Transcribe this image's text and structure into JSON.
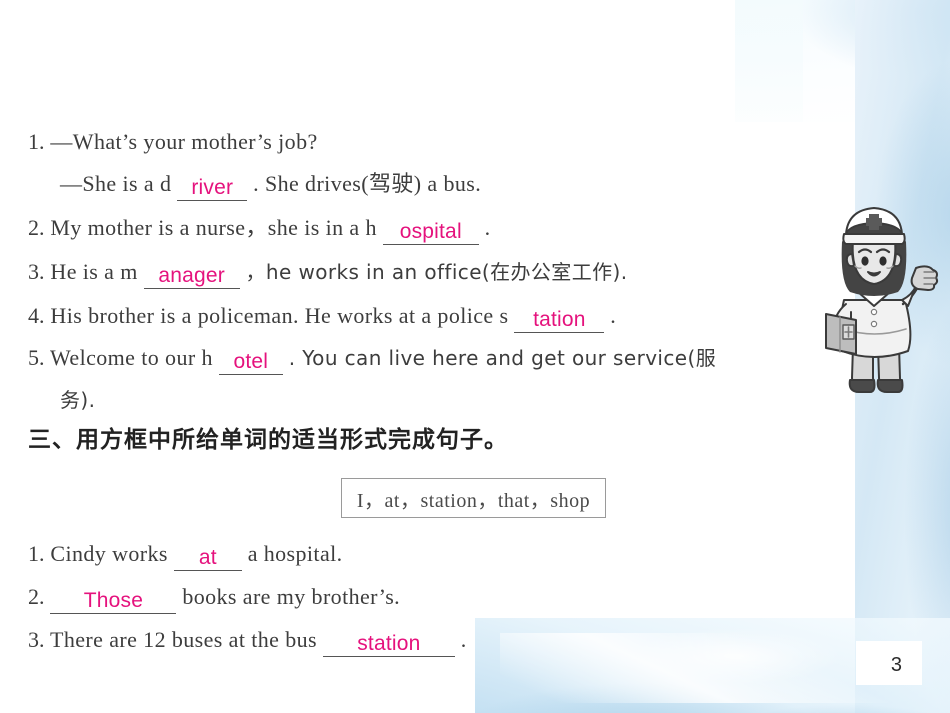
{
  "page": {
    "number": "3",
    "accent_pink": "#e5127d",
    "text_color": "#3d3d3d",
    "decor_blue": "#bcdcf0"
  },
  "exercise_two": {
    "items": [
      {
        "num": "1.",
        "pre": "—What’s your mother’s job?"
      },
      {
        "num": "",
        "pre": "—She is a d",
        "answer": "river",
        "post": ". She drives(驾驶) a bus."
      },
      {
        "num": "2.",
        "pre": "My mother is a nurse，she is in a h",
        "answer": "ospital",
        "post": "."
      },
      {
        "num": "3.",
        "pre": "He is a m",
        "answer": "anager",
        "post": "，he works in an office(在办公室工作)."
      },
      {
        "num": "4.",
        "pre": "His brother is a policeman. He works at a police s",
        "answer": "tation",
        "post": "."
      },
      {
        "num": "5.",
        "pre": "Welcome to our h",
        "answer": "otel",
        "post": ". You can live here and get our service(服"
      },
      {
        "num": "",
        "pre": "务)."
      }
    ]
  },
  "exercise_three": {
    "heading": "三、用方框中所给单词的适当形式完成句子。",
    "word_box": "I，at，station，that，shop",
    "word_box_items": [
      "I",
      "at",
      "station",
      "that",
      "shop"
    ],
    "items": [
      {
        "num": "1.",
        "pre": "Cindy works",
        "answer": "at",
        "post": "a hospital."
      },
      {
        "num": "2.",
        "pre": "",
        "answer": "Those",
        "post": "books are my brother’s."
      },
      {
        "num": "3.",
        "pre": "There are 12 buses at the bus",
        "answer": "station",
        "post": "."
      }
    ]
  },
  "illustration": {
    "name": "cartoon-nurse",
    "description": "grayscale cartoon nurse waving, wearing cap with cross, holding medical bag"
  }
}
